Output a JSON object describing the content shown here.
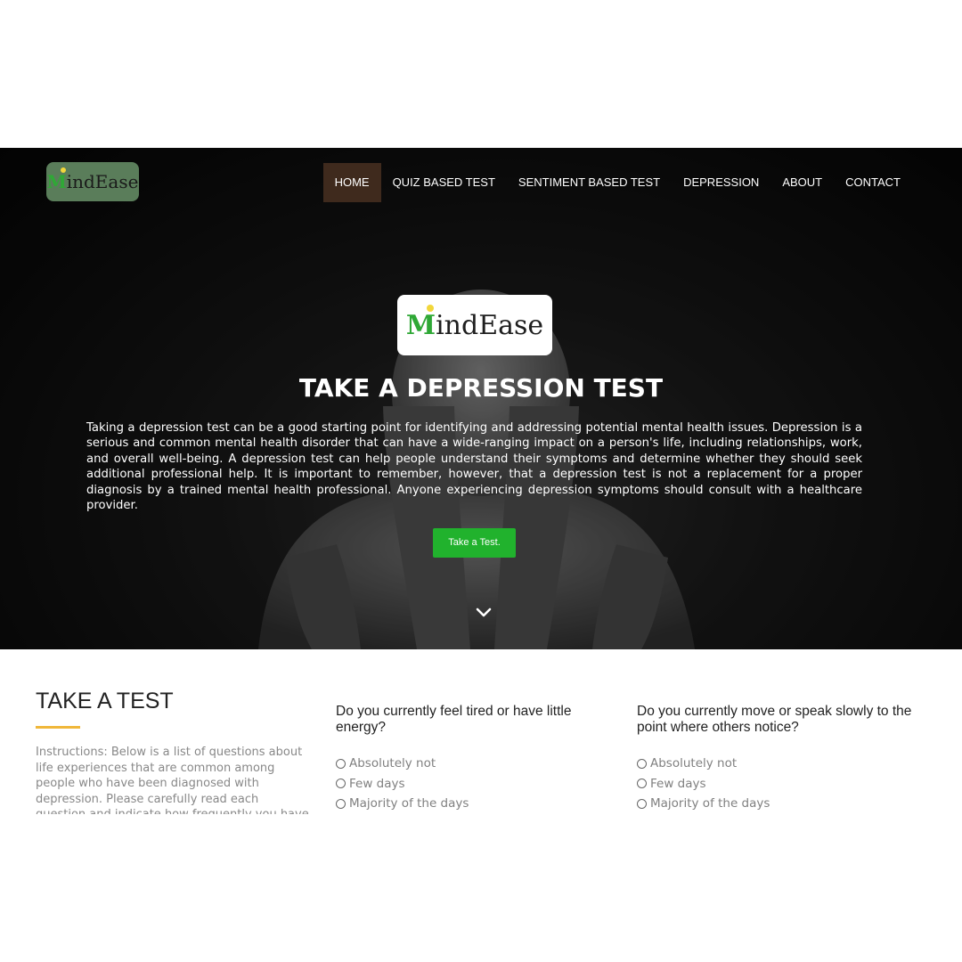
{
  "header": {
    "logo_text": "MindEase",
    "nav": [
      {
        "label": "HOME",
        "active": true
      },
      {
        "label": "QUIZ BASED TEST"
      },
      {
        "label": "SENTIMENT BASED TEST"
      },
      {
        "label": "DEPRESSION"
      },
      {
        "label": "ABOUT"
      },
      {
        "label": "CONTACT"
      }
    ]
  },
  "hero": {
    "logo_text": "MindEase",
    "title": "TAKE A DEPRESSION TEST",
    "description": "Taking a depression test can be a good starting point for identifying and addressing potential mental health issues. Depression is a serious and common mental health disorder that can have a wide-ranging impact on a person's life, including relationships, work, and overall well-being. A depression test can help people understand their symptoms and determine whether they should seek additional professional help. It is important to remember, however, that a depression test is not a replacement for a proper diagnosis by a trained mental health professional. Anyone experiencing depression symptoms should consult with a healthcare provider.",
    "cta_label": "Take a Test.",
    "scroll_icon": "chevron-down-icon"
  },
  "test": {
    "title": "TAKE A TEST",
    "instructions": "Instructions: Below is a list of questions about life experiences that are common among people who have been diagnosed with depression. Please carefully read each question and indicate how frequently you have faced the",
    "questions": [
      {
        "text": "Do you currently feel tired or have little energy?",
        "options": [
          "Absolutely not",
          "Few days",
          "Majority of the days"
        ]
      },
      {
        "text": "Do you currently move or speak slowly to the point where others notice?",
        "options": [
          "Absolutely not",
          "Few days",
          "Majority of the days"
        ]
      }
    ]
  },
  "colors": {
    "nav_active_bg": "#3f2a1d",
    "cta_green": "#21b22d",
    "logo_green": "#2fa836",
    "accent_underline": "#f0b73a"
  }
}
